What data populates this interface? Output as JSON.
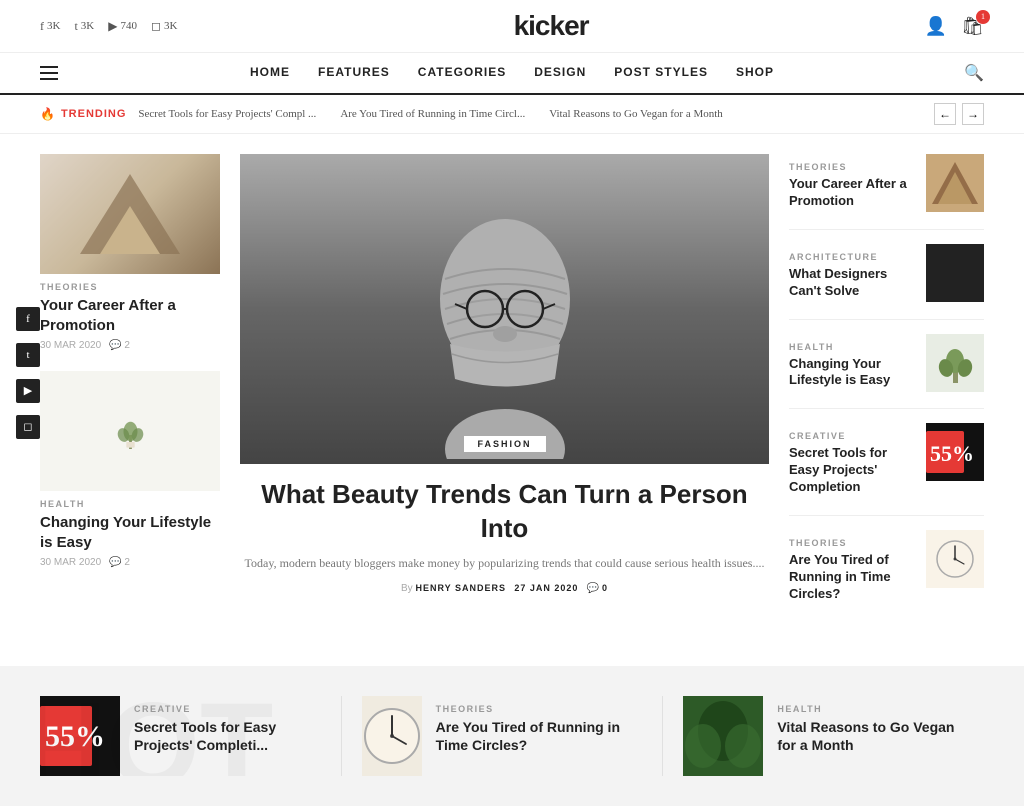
{
  "site": {
    "name": "kicker"
  },
  "topbar": {
    "social": [
      {
        "platform": "facebook",
        "icon": "f",
        "count": "3K"
      },
      {
        "platform": "twitter",
        "icon": "t",
        "count": "3K"
      },
      {
        "platform": "youtube",
        "icon": "▶",
        "count": "740"
      },
      {
        "platform": "instagram",
        "icon": "◻",
        "count": "3K"
      }
    ]
  },
  "nav": {
    "items": [
      {
        "label": "HOME",
        "active": true
      },
      {
        "label": "FEATURES"
      },
      {
        "label": "CATEGORIES"
      },
      {
        "label": "DESIGN"
      },
      {
        "label": "POST STYLES"
      },
      {
        "label": "SHOP"
      }
    ]
  },
  "trending": {
    "label": "TRENDING",
    "items": [
      "Secret Tools for Easy Projects' Compl ...",
      "Are You Tired of Running in Time Circl...",
      "Vital Reasons to Go Vegan for a Month"
    ]
  },
  "left_articles": [
    {
      "category": "THEORIES",
      "title": "Your Career After a Promotion",
      "date": "30 MAR 2020",
      "comments": "2",
      "img_type": "triangle"
    },
    {
      "category": "HEALTH",
      "title": "Changing Your Lifestyle is Easy",
      "date": "30 MAR 2020",
      "comments": "2",
      "img_type": "plant"
    }
  ],
  "hero": {
    "category": "FASHION",
    "title": "What Beauty Trends Can Turn a Person Into",
    "excerpt": "Today, modern beauty bloggers make money by popularizing trends that could cause serious health issues....",
    "author": "HENRY SANDERS",
    "date": "27 JAN 2020",
    "comments": "0"
  },
  "right_articles": [
    {
      "category": "THEORIES",
      "title": "Your Career After a Promotion",
      "img_type": "wood"
    },
    {
      "category": "ARCHITECTURE",
      "title": "What Designers Can't Solve",
      "img_type": "dark"
    },
    {
      "category": "HEALTH",
      "title": "Changing Your Lifestyle is Easy",
      "img_type": "plant"
    },
    {
      "category": "CREATIVE",
      "title": "Secret Tools for Easy Projects' Completion",
      "img_type": "red"
    },
    {
      "category": "THEORIES",
      "title": "Are You Tired of Running in Time Circles?",
      "img_type": "clock"
    }
  ],
  "bottom_articles": [
    {
      "category": "CREATIVE",
      "title": "Secret Tools for Easy Projects' Completi...",
      "img_type": "red"
    },
    {
      "category": "THEORIES",
      "title": "Are You Tired of Running in Time Circles?",
      "img_type": "clock"
    },
    {
      "category": "HEALTH",
      "title": "Vital Reasons to Go Vegan for a Month",
      "img_type": "green"
    }
  ],
  "sidebar_social": [
    "f",
    "t",
    "▶",
    "◻"
  ],
  "cart_count": "1",
  "colors": {
    "accent": "#e53935",
    "dark": "#222222",
    "light_gray": "#f3f3f3"
  }
}
